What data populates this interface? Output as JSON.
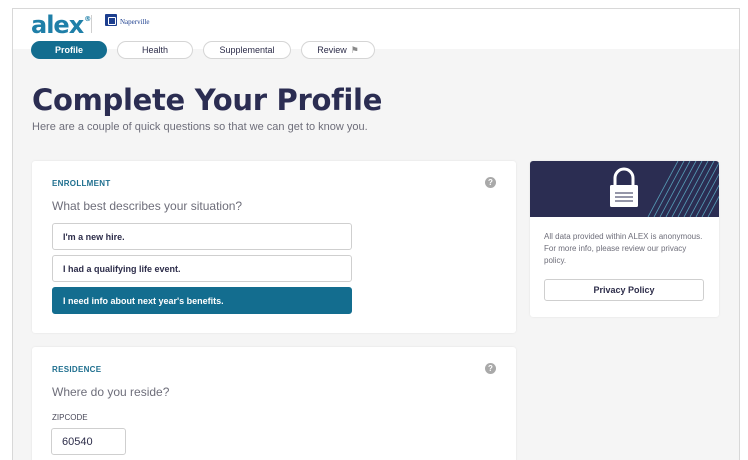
{
  "header": {
    "logo_text": "alex",
    "logo_mark": "®",
    "partner_name": "Naperville"
  },
  "tabs": [
    {
      "label": "Profile",
      "active": true
    },
    {
      "label": "Health",
      "active": false
    },
    {
      "label": "Supplemental",
      "active": false
    },
    {
      "label": "Review",
      "active": false,
      "icon": "flag-icon"
    }
  ],
  "page": {
    "title": "Complete Your Profile",
    "subtitle": "Here are a couple of quick questions so that we can get to know you."
  },
  "enrollment": {
    "label": "ENROLLMENT",
    "help_icon": "?",
    "question": "What best describes your situation?",
    "options": [
      {
        "label": "I'm a new hire.",
        "selected": false
      },
      {
        "label": "I had a qualifying life event.",
        "selected": false
      },
      {
        "label": "I need info about next year's benefits.",
        "selected": true
      }
    ]
  },
  "residence": {
    "label": "RESIDENCE",
    "help_icon": "?",
    "question": "Where do you reside?",
    "zip_label": "ZIPCODE",
    "zip_value": "60540"
  },
  "privacy": {
    "icon": "padlock-icon",
    "text": "All data provided within ALEX is anonymous. For more info, please review our privacy policy.",
    "button_label": "Privacy Policy"
  },
  "colors": {
    "brand_blue": "#1f7fa8",
    "accent_teal": "#136d8f",
    "navy": "#2b2d52",
    "background": "#f5f5f5"
  }
}
